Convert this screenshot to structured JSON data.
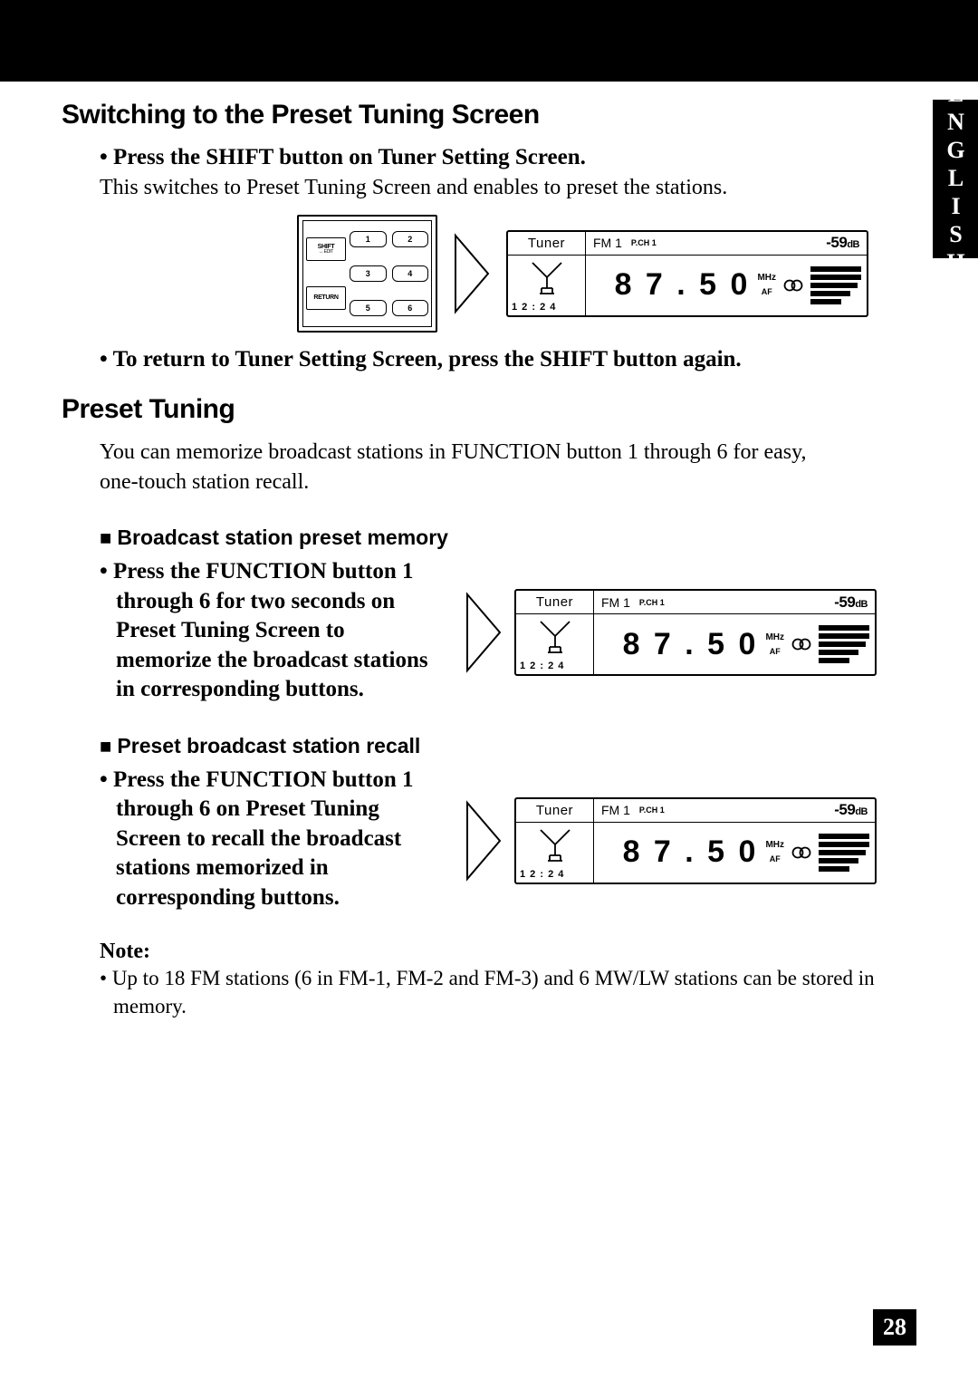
{
  "language_tab": "ENGLISH",
  "page_number": "28",
  "section1": {
    "title": "Switching to the Preset Tuning Screen",
    "bullet1": "Press the SHIFT button on Tuner Setting Screen.",
    "body1": "This switches to Preset Tuning Screen and enables to preset the stations.",
    "bullet2": "To return to Tuner Setting Screen, press the SHIFT button again."
  },
  "remote": {
    "shift_label": "SHIFT",
    "shift_sub": "↔ EDIT",
    "return_label": "RETURN",
    "buttons": [
      "1",
      "2",
      "3",
      "4",
      "5",
      "6"
    ]
  },
  "lcd": {
    "mode": "Tuner",
    "time": "1 2 : 2 4",
    "band": "FM 1",
    "pch": "P.CH 1",
    "db": "-59",
    "db_unit": "dB",
    "freq": "8 7 . 5 0",
    "mhz": "MHz",
    "af": "AF"
  },
  "section2": {
    "title": "Preset Tuning",
    "intro": "You can memorize broadcast stations in FUNCTION button 1 through 6 for easy, one-touch station recall.",
    "sub1": "Broadcast station preset memory",
    "sub1_bullet": "Press the FUNCTION button 1 through 6 for two seconds on Preset Tuning Screen to memorize the broadcast stations in corresponding buttons.",
    "sub2": "Preset broadcast station recall",
    "sub2_bullet": "Press the FUNCTION button 1 through 6 on Preset Tuning Screen to recall the broadcast stations memorized in corresponding buttons."
  },
  "note": {
    "label": "Note:",
    "item1": "Up to 18 FM stations (6 in FM-1, FM-2 and FM-3) and 6 MW/LW stations can be stored in memory."
  }
}
